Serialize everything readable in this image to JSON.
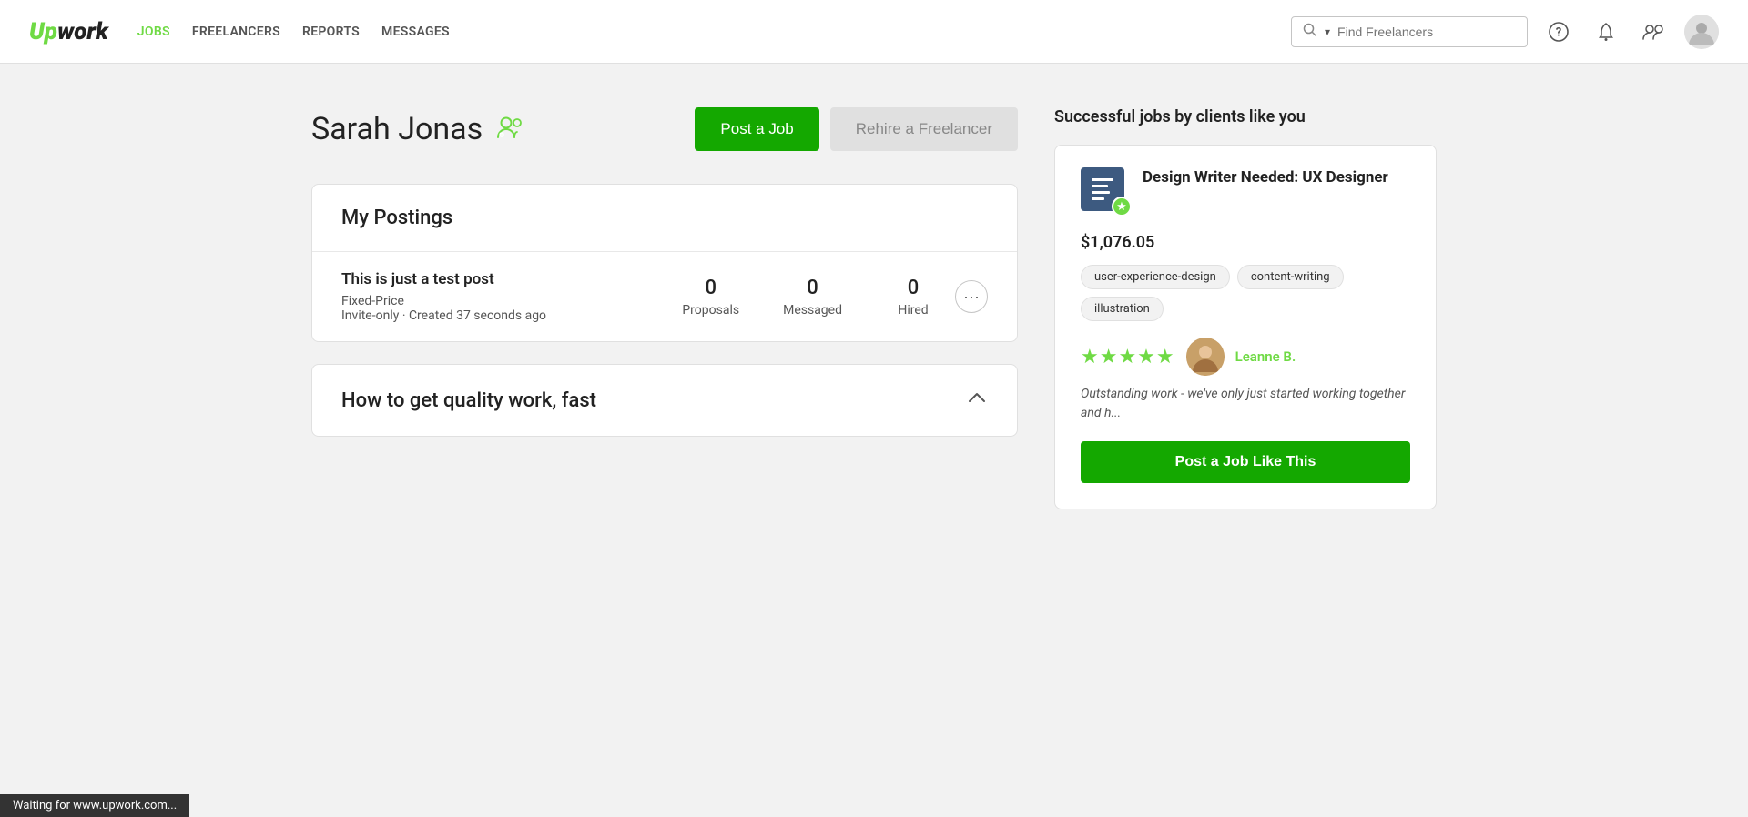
{
  "header": {
    "logo_up": "Up",
    "logo_work": "work",
    "nav": [
      {
        "id": "jobs",
        "label": "JOBS",
        "active": true
      },
      {
        "id": "freelancers",
        "label": "FREELANCERS",
        "active": false
      },
      {
        "id": "reports",
        "label": "REPORTS",
        "active": false
      },
      {
        "id": "messages",
        "label": "MESSAGES",
        "active": false
      }
    ],
    "search_placeholder": "Find Freelancers",
    "search_dropdown": "▾"
  },
  "page": {
    "user_name": "Sarah Jonas",
    "post_job_label": "Post a Job",
    "rehire_label": "Rehire a Freelancer"
  },
  "my_postings": {
    "section_title": "My Postings",
    "posting": {
      "title": "This is just a test post",
      "type": "Fixed-Price",
      "meta": "Invite-only · Created 37 seconds ago",
      "proposals": 0,
      "messaged": 0,
      "hired": 0,
      "proposals_label": "Proposals",
      "messaged_label": "Messaged",
      "hired_label": "Hired"
    }
  },
  "how_to": {
    "title": "How to get quality work, fast"
  },
  "sidebar": {
    "heading": "Successful jobs by clients like you",
    "job_card": {
      "title": "Design Writer Needed: UX Designer",
      "amount": "$1,076.05",
      "tags": [
        "user-experience-design",
        "content-writing",
        "illustration"
      ],
      "stars": "★★★★★",
      "reviewer_name": "Leanne B.",
      "review_text": "Outstanding work - we've only just started working together and h...",
      "cta_label": "Post a Job Like This"
    }
  },
  "status_bar": {
    "text": "Waiting for www.upwork.com..."
  },
  "colors": {
    "green": "#14a800",
    "light_green": "#6fda44",
    "grey_btn": "#e0e0e0"
  }
}
